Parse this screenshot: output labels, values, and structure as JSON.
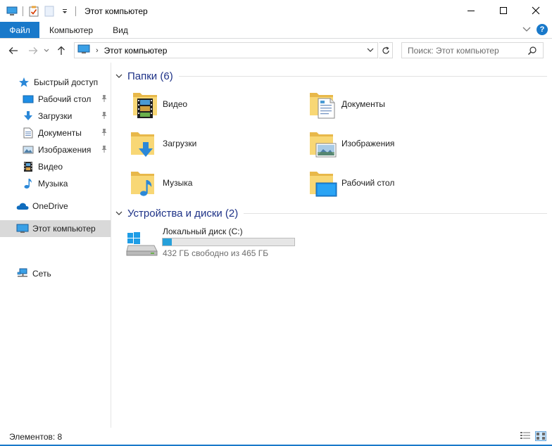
{
  "window": {
    "title": "Этот компьютер"
  },
  "ribbon": {
    "tabs": [
      "Файл",
      "Компьютер",
      "Вид"
    ]
  },
  "navbar": {
    "address": "Этот компьютер",
    "search_placeholder": "Поиск: Этот компьютер"
  },
  "sidebar": {
    "quick_access": "Быстрый доступ",
    "quick_items": [
      {
        "label": "Рабочий стол",
        "icon": "desktop-icon",
        "pinned": true
      },
      {
        "label": "Загрузки",
        "icon": "downloads-icon",
        "pinned": true
      },
      {
        "label": "Документы",
        "icon": "documents-icon",
        "pinned": true
      },
      {
        "label": "Изображения",
        "icon": "pictures-icon",
        "pinned": true
      },
      {
        "label": "Видео",
        "icon": "video-icon",
        "pinned": false
      },
      {
        "label": "Музыка",
        "icon": "music-icon",
        "pinned": false
      }
    ],
    "onedrive": "OneDrive",
    "this_pc": "Этот компьютер",
    "network": "Сеть"
  },
  "content": {
    "folders_header": "Папки (6)",
    "folders": [
      {
        "label": "Видео",
        "icon": "video-folder-icon"
      },
      {
        "label": "Документы",
        "icon": "documents-folder-icon"
      },
      {
        "label": "Загрузки",
        "icon": "downloads-folder-icon"
      },
      {
        "label": "Изображения",
        "icon": "pictures-folder-icon"
      },
      {
        "label": "Музыка",
        "icon": "music-folder-icon"
      },
      {
        "label": "Рабочий стол",
        "icon": "desktop-folder-icon"
      }
    ],
    "devices_header": "Устройства и диски (2)",
    "drive": {
      "name": "Локальный диск (C:)",
      "free_text": "432 ГБ свободно из 465 ГБ",
      "used_fraction": 0.071
    }
  },
  "statusbar": {
    "count": "Элементов: 8"
  },
  "colors": {
    "accent": "#1979ca",
    "folder": "#f8d775",
    "folder_dark": "#e8b84a",
    "drive_bar": "#26a0da",
    "group_title": "#1e3287"
  }
}
